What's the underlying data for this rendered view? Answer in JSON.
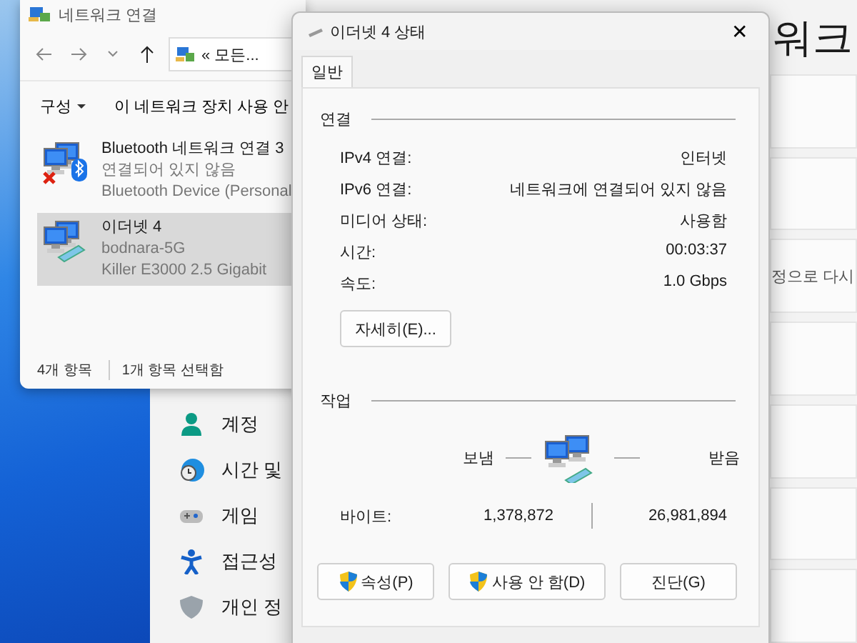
{
  "settings_window": {
    "heading": "워크",
    "notice": "정으로 다시",
    "sidebar": {
      "items": [
        {
          "label": "계정"
        },
        {
          "label": "시간 및"
        },
        {
          "label": "게임"
        },
        {
          "label": "접근성"
        },
        {
          "label": "개인 정"
        }
      ]
    }
  },
  "explorer_window": {
    "title": "네트워크 연결",
    "address": "« 모든...",
    "toolbar": [
      {
        "label": "구성",
        "dropdown": true
      },
      {
        "label": "이 네트워크 장치 사용 안",
        "dropdown": false
      }
    ],
    "items": [
      {
        "name": "Bluetooth 네트워크 연결 3",
        "status": "연결되어 있지 않음",
        "device": "Bluetooth Device (Personal",
        "kind": "bluetooth",
        "disconnected": true,
        "selected": false
      },
      {
        "name": "이더넷 4",
        "status": "bodnara-5G",
        "device": "Killer E3000 2.5 Gigabit",
        "kind": "ethernet",
        "disconnected": false,
        "selected": true
      }
    ],
    "status_bar": [
      "4개 항목",
      "1개 항목 선택함"
    ]
  },
  "status_dialog": {
    "title": "이더넷 4 상태",
    "close": "✕",
    "tabs": [
      {
        "label": "일반",
        "selected": true
      }
    ],
    "connection": {
      "title": "연결",
      "rows": [
        {
          "label": "IPv4 연결:",
          "value": "인터넷"
        },
        {
          "label": "IPv6 연결:",
          "value": "네트워크에 연결되어 있지 않음"
        },
        {
          "label": "미디어 상태:",
          "value": "사용함"
        },
        {
          "label": "시간:",
          "value": "00:03:37"
        },
        {
          "label": "속도:",
          "value": "1.0 Gbps"
        }
      ],
      "details_button": "자세히(E)..."
    },
    "activity": {
      "title": "작업",
      "sent_label": "보냄",
      "received_label": "받음",
      "bytes_label": "바이트:",
      "sent": "1,378,872",
      "received": "26,981,894"
    },
    "buttons": [
      {
        "label": "속성(P)",
        "shield": true
      },
      {
        "label": "사용 안 함(D)",
        "shield": true
      },
      {
        "label": "진단(G)",
        "shield": false
      }
    ]
  }
}
